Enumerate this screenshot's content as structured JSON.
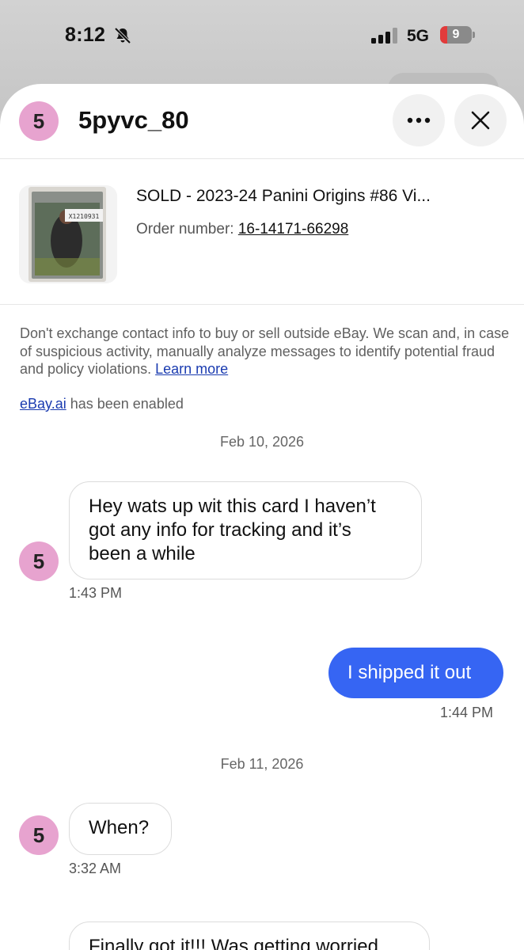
{
  "status_bar": {
    "time": "8:12",
    "network": "5G",
    "battery_level": "9",
    "battery_fraction": 0.09
  },
  "header": {
    "avatar_letter": "5",
    "username": "5pyvc_80"
  },
  "item": {
    "title": "SOLD - 2023-24 Panini Origins #86 Vi...",
    "order_label": "Order number:",
    "order_number": "16-14171-66298",
    "thumb_label": "X1210931"
  },
  "notice": {
    "text": "Don't exchange contact info to buy or sell outside eBay. We scan and, in case of suspicious activity, manually analyze messages to identify potential fraud and policy violations.",
    "learn_more": "Learn more"
  },
  "ai_notice": {
    "link": "eBay.ai",
    "text": "has been enabled"
  },
  "conversation": {
    "date_1": "Feb 10, 2026",
    "msg_1": {
      "lines": [
        "Hey wats up wit this card I haven’t",
        "got any info for tracking and it’s",
        "been a while"
      ],
      "time": "1:43 PM"
    },
    "msg_2": {
      "text": "I shipped it out",
      "time": "1:44 PM"
    },
    "date_2": "Feb 11, 2026",
    "msg_3": {
      "text": "When?",
      "time": "3:32 AM"
    },
    "msg_4": {
      "text": "Finally got it!!! Was getting worried"
    }
  },
  "colors": {
    "accent_blue": "#3665f3",
    "avatar_pink": "#e7a3cf",
    "link_blue": "#1a3bb0"
  }
}
